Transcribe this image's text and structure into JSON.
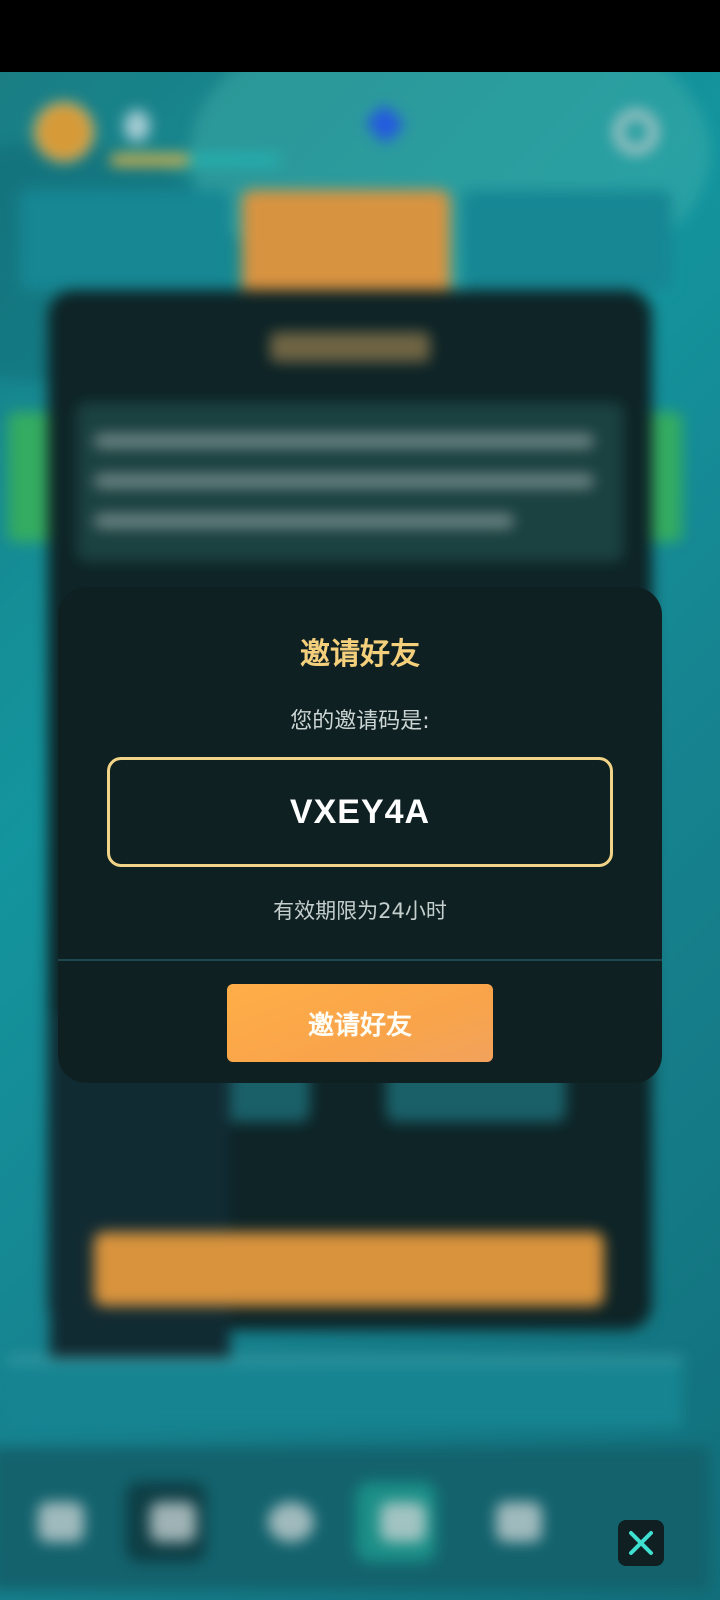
{
  "modal": {
    "title": "邀请好友",
    "subtitle": "您的邀请码是:",
    "invite_code": "VXEY4A",
    "validity": "有效期限为24小时",
    "invite_button": "邀请好友"
  },
  "colors": {
    "accent": "#f4cf7c",
    "button": "#f9a44a",
    "modal_bg": "#0f2022",
    "background": "#16aab4"
  },
  "icons": [
    "close-icon",
    "settings-gear-icon",
    "water-drop-icon",
    "gem-icon"
  ]
}
